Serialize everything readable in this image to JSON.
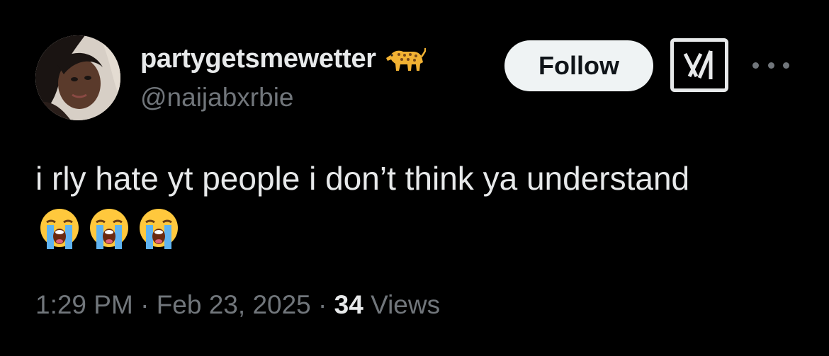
{
  "author": {
    "display_name": "partygetsmewetter",
    "name_icon": "leopard-emoji-icon",
    "handle": "@naijabxrbie",
    "avatar_icon": "profile-photo"
  },
  "actions": {
    "follow_label": "Follow",
    "grok_icon": "grok-logo-icon",
    "more_icon": "more-options-icon"
  },
  "tweet": {
    "text": "i rly hate yt people i don’t think ya understand",
    "emojis": [
      "loudly-crying-face-icon",
      "loudly-crying-face-icon",
      "loudly-crying-face-icon"
    ]
  },
  "meta": {
    "time": "1:29 PM",
    "separator": "·",
    "date": "Feb 23, 2025",
    "views_count": "34",
    "views_label": "Views"
  },
  "colors": {
    "background": "#000000",
    "primary_text": "#e7e9ea",
    "secondary_text": "#71767b",
    "follow_bg": "#eff3f4",
    "emoji_yellow": "#ffc83d",
    "tears_blue": "#5fb3f0"
  }
}
